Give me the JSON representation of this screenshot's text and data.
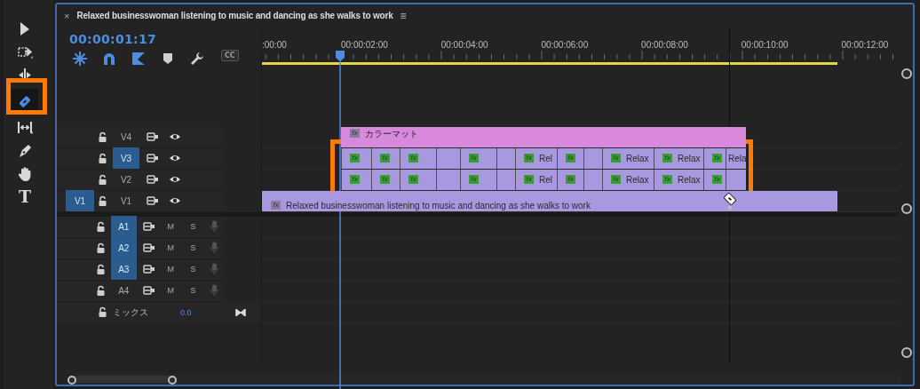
{
  "window": {
    "close": "×",
    "title": "Relaxed businesswoman listening to music and dancing as she walks to work",
    "menu": "≡"
  },
  "tools": [
    {
      "kind": "select",
      "selected": false
    },
    {
      "kind": "track-select",
      "selected": false
    },
    {
      "kind": "ripple",
      "selected": false
    },
    {
      "kind": "razor",
      "selected": true
    },
    {
      "kind": "slip",
      "selected": false
    },
    {
      "kind": "pen",
      "selected": false
    },
    {
      "kind": "hand",
      "selected": false
    },
    {
      "kind": "type",
      "glyph": "T",
      "selected": false
    }
  ],
  "timecode": "00:00:01:17",
  "header_buttons": [
    {
      "kind": "snap",
      "on": true
    },
    {
      "kind": "linked",
      "on": true
    },
    {
      "kind": "insert",
      "on": true
    },
    {
      "kind": "marker",
      "on": false
    },
    {
      "kind": "settings",
      "on": false
    },
    {
      "kind": "captions",
      "label": "CC",
      "disabled": true
    }
  ],
  "ruler": {
    "labels": [
      ":00:00",
      "00:00:02:00",
      "00:00:04:00",
      "00:00:06:00",
      "00:00:08:00",
      "00:00:10:00",
      "00:00:12:00"
    ]
  },
  "video_tracks": [
    {
      "name": "V4",
      "targeted": false,
      "clip": {
        "kind": "matte",
        "fx": "fx",
        "label": "カラーマット"
      }
    },
    {
      "name": "V3",
      "targeted": true,
      "clip": {
        "kind": "cut",
        "segments": [
          {
            "kind": "effect",
            "fx": "fx"
          },
          {
            "kind": "effect",
            "fx": "fx"
          },
          {
            "kind": "effect",
            "fx": "fx"
          },
          {
            "kind": "plain"
          },
          {
            "kind": "effect",
            "fx": "fx"
          },
          {
            "kind": "plain"
          },
          {
            "kind": "effect",
            "fx": "fx",
            "label": "Rel"
          },
          {
            "kind": "effect",
            "fx": "fx"
          },
          {
            "kind": "plain"
          },
          {
            "kind": "effect",
            "fx": "fx",
            "label": "Relax"
          },
          {
            "kind": "effect",
            "fx": "fx",
            "label": "Relax"
          },
          {
            "kind": "effect",
            "fx": "fx"
          },
          {
            "kind": "plain",
            "label": "Rela"
          }
        ]
      }
    },
    {
      "name": "V2",
      "targeted": false,
      "clip": {
        "kind": "cut",
        "segments": [
          {
            "kind": "effect",
            "fx": "fx"
          },
          {
            "kind": "effect",
            "fx": "fx"
          },
          {
            "kind": "effect",
            "fx": "fx"
          },
          {
            "kind": "plain"
          },
          {
            "kind": "effect",
            "fx": "fx"
          },
          {
            "kind": "plain"
          },
          {
            "kind": "effect",
            "fx": "fx",
            "label": "Rel"
          },
          {
            "kind": "effect",
            "fx": "fx"
          },
          {
            "kind": "plain"
          },
          {
            "kind": "effect",
            "fx": "fx",
            "label": "Relax"
          },
          {
            "kind": "effect",
            "fx": "fx",
            "label": "Relax"
          },
          {
            "kind": "effect",
            "fx": "fx"
          },
          {
            "kind": "plain"
          }
        ]
      }
    },
    {
      "name": "V1",
      "targeted": false,
      "source_patch": "V1",
      "clip": {
        "kind": "video",
        "fx": "fx",
        "label": "Relaxed businesswoman listening to music and dancing as she walks to work"
      }
    }
  ],
  "audio_tracks": [
    {
      "name": "A1",
      "targeted": true,
      "mute": "M",
      "solo": "S"
    },
    {
      "name": "A2",
      "targeted": true,
      "mute": "M",
      "solo": "S"
    },
    {
      "name": "A3",
      "targeted": true,
      "mute": "M",
      "solo": "S"
    },
    {
      "name": "A4",
      "targeted": false,
      "mute": "M",
      "solo": "S"
    }
  ],
  "mix": {
    "label": "ミックス",
    "value": "0.0"
  }
}
